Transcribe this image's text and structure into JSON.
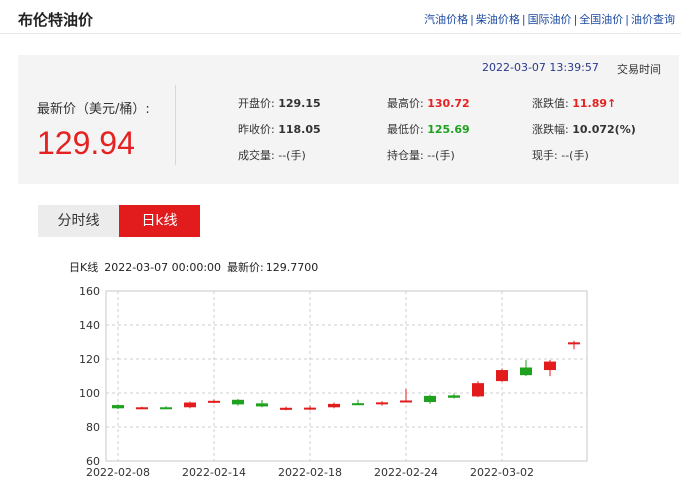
{
  "header": {
    "title": "布伦特油价",
    "links": [
      "汽油价格",
      "柴油价格",
      "国际油价",
      "全国油价",
      "油价查询"
    ],
    "separator": "|"
  },
  "quote": {
    "timestamp": "2022-03-07 13:39:57",
    "trade_time_label": "交易时间",
    "latest_label": "最新价（美元/桶）:",
    "latest_value": "129.94",
    "fields": {
      "open": {
        "label": "开盘价:",
        "value": "129.15"
      },
      "prev_close": {
        "label": "昨收价:",
        "value": "118.05"
      },
      "volume": {
        "label": "成交量:",
        "value": "--(手)"
      },
      "high": {
        "label": "最高价:",
        "value": "130.72"
      },
      "low": {
        "label": "最低价:",
        "value": "125.69"
      },
      "open_interest": {
        "label": "持仓量:",
        "value": "--(手)"
      },
      "change": {
        "label": "涨跌值:",
        "value": "11.89",
        "arrow": "↑"
      },
      "change_pct": {
        "label": "涨跌幅:",
        "value": "10.072(%)"
      },
      "current_hand": {
        "label": "现手:",
        "value": "--(手)"
      }
    }
  },
  "tabs": [
    {
      "label": "分时线",
      "active": false
    },
    {
      "label": "日k线",
      "active": true
    }
  ],
  "chart_info": {
    "type_label": "日K线",
    "date": "2022-03-07 00:00:00",
    "latest_label": "最新价:",
    "latest_value": "129.7700"
  },
  "colors": {
    "up": "#e21c1c",
    "down": "#1ea11e",
    "accent": "#e21c1c",
    "link": "#1a4aa0"
  },
  "chart_data": {
    "type": "candlestick",
    "ylim": [
      60,
      160
    ],
    "yticks": [
      60,
      80,
      100,
      120,
      140,
      160
    ],
    "xtick_labels": [
      "2022-02-08",
      "2022-02-14",
      "2022-02-18",
      "2022-02-24",
      "2022-03-02"
    ],
    "xtick_index": [
      0,
      4,
      8,
      12,
      16
    ],
    "grid": true,
    "candles": [
      {
        "date": "2022-02-08",
        "open": 92.9,
        "close": 91.0,
        "high": 93.3,
        "low": 90.6
      },
      {
        "date": "2022-02-09",
        "open": 91.2,
        "close": 91.6,
        "high": 92.0,
        "low": 90.6
      },
      {
        "date": "2022-02-10",
        "open": 91.6,
        "close": 91.3,
        "high": 92.2,
        "low": 90.8
      },
      {
        "date": "2022-02-11",
        "open": 91.6,
        "close": 94.4,
        "high": 95.0,
        "low": 91.0
      },
      {
        "date": "2022-02-14",
        "open": 94.6,
        "close": 95.4,
        "high": 96.2,
        "low": 94.0
      },
      {
        "date": "2022-02-15",
        "open": 96.0,
        "close": 93.3,
        "high": 96.5,
        "low": 92.6
      },
      {
        "date": "2022-02-16",
        "open": 93.9,
        "close": 92.1,
        "high": 95.9,
        "low": 91.6
      },
      {
        "date": "2022-02-17",
        "open": 90.1,
        "close": 91.3,
        "high": 92.0,
        "low": 89.8
      },
      {
        "date": "2022-02-18",
        "open": 90.3,
        "close": 91.4,
        "high": 92.6,
        "low": 89.9
      },
      {
        "date": "2022-02-21",
        "open": 91.6,
        "close": 93.6,
        "high": 94.4,
        "low": 91.0
      },
      {
        "date": "2022-02-22",
        "open": 94.0,
        "close": 93.6,
        "high": 96.0,
        "low": 93.0
      },
      {
        "date": "2022-02-23",
        "open": 93.4,
        "close": 94.5,
        "high": 95.2,
        "low": 92.6
      },
      {
        "date": "2022-02-24",
        "open": 94.8,
        "close": 95.6,
        "high": 102.4,
        "low": 94.6
      },
      {
        "date": "2022-02-25",
        "open": 98.3,
        "close": 94.7,
        "high": 99.0,
        "low": 93.6
      },
      {
        "date": "2022-02-28",
        "open": 98.6,
        "close": 97.2,
        "high": 99.6,
        "low": 96.8
      },
      {
        "date": "2022-03-01",
        "open": 98.0,
        "close": 105.8,
        "high": 107.0,
        "low": 97.6
      },
      {
        "date": "2022-03-02",
        "open": 107.0,
        "close": 113.5,
        "high": 114.4,
        "low": 106.6
      },
      {
        "date": "2022-03-03",
        "open": 115.0,
        "close": 110.5,
        "high": 119.5,
        "low": 109.9
      },
      {
        "date": "2022-03-04",
        "open": 113.5,
        "close": 118.5,
        "high": 119.5,
        "low": 109.9
      },
      {
        "date": "2022-03-07",
        "open": 129.2,
        "close": 129.8,
        "high": 130.7,
        "low": 125.7
      }
    ]
  }
}
